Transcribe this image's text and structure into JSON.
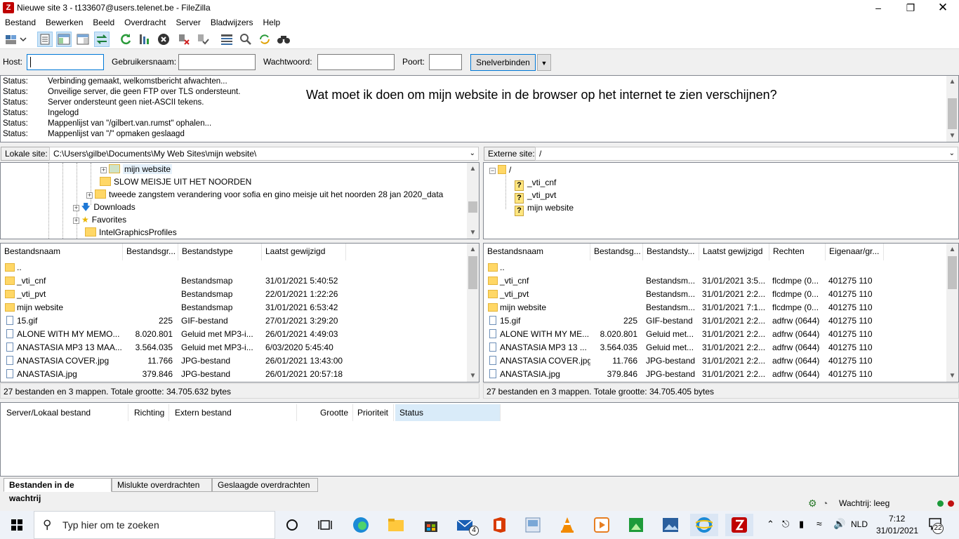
{
  "window": {
    "title": "Nieuwe site 3 - t133607@users.telenet.be - FileZilla",
    "app_icon": "Z"
  },
  "menu": [
    "Bestand",
    "Bewerken",
    "Beeld",
    "Overdracht",
    "Server",
    "Bladwijzers",
    "Help"
  ],
  "toolbar_icons": [
    "site-manager-icon",
    "toggle-log-icon",
    "toggle-local-tree-icon",
    "toggle-remote-tree-icon",
    "transfer-queue-icon",
    "refresh-icon",
    "process-queue-icon",
    "cancel-icon",
    "disconnect-icon",
    "reconnect-icon",
    "directory-listing-filters-icon",
    "compare-icon",
    "sync-browse-icon",
    "search-files-icon"
  ],
  "quickconnect": {
    "host_label": "Host:",
    "host_value": "",
    "user_label": "Gebruikersnaam:",
    "user_value": "",
    "pass_label": "Wachtwoord:",
    "pass_value": "",
    "port_label": "Poort:",
    "port_value": "",
    "button": "Snelverbinden"
  },
  "log": [
    {
      "key": "Status:",
      "msg": "Verbinding gemaakt, welkomstbericht afwachten..."
    },
    {
      "key": "Status:",
      "msg": "Onveilige server, die geen FTP over TLS ondersteunt."
    },
    {
      "key": "Status:",
      "msg": "Server ondersteunt geen niet-ASCII tekens."
    },
    {
      "key": "Status:",
      "msg": "Ingelogd"
    },
    {
      "key": "Status:",
      "msg": "Mappenlijst van \"/gilbert.van.rumst\" ophalen..."
    },
    {
      "key": "Status:",
      "msg": "Mappenlijst van \"/\" opmaken geslaagd"
    }
  ],
  "overlay_question": "Wat moet ik doen om mijn website in de browser op het internet te zien verschijnen?",
  "local": {
    "site_label": "Lokale site:",
    "path": "C:\\Users\\gilbe\\Documents\\My Web Sites\\mijn website\\",
    "tree": [
      "mijn website",
      "SLOW MEISJE UIT HET NOORDEN",
      "tweede zangstem verandering voor sofia en gino meisje uit het noorden 28 jan 2020_data",
      "Downloads",
      "Favorites",
      "IntelGraphicsProfiles"
    ],
    "headers": [
      "Bestandsnaam",
      "Bestandsgr...",
      "Bestandstype",
      "Laatst gewijzigd"
    ],
    "files": [
      {
        "name": "..",
        "size": "",
        "type": "",
        "date": "",
        "icon": "folder"
      },
      {
        "name": "_vti_cnf",
        "size": "",
        "type": "Bestandsmap",
        "date": "31/01/2021 5:40:52",
        "icon": "folder"
      },
      {
        "name": "_vti_pvt",
        "size": "",
        "type": "Bestandsmap",
        "date": "22/01/2021 1:22:26",
        "icon": "folder"
      },
      {
        "name": "mijn website",
        "size": "",
        "type": "Bestandsmap",
        "date": "31/01/2021 6:53:42",
        "icon": "folder"
      },
      {
        "name": "15.gif",
        "size": "225",
        "type": "GIF-bestand",
        "date": "27/01/2021 3:29:20",
        "icon": "file"
      },
      {
        "name": "ALONE WITH MY MEMO...",
        "size": "8.020.801",
        "type": "Geluid met MP3-i...",
        "date": "26/01/2021 4:49:03",
        "icon": "file"
      },
      {
        "name": "ANASTASIA  MP3 13 MAA...",
        "size": "3.564.035",
        "type": "Geluid met MP3-i...",
        "date": "6/03/2020 5:45:40",
        "icon": "file"
      },
      {
        "name": "ANASTASIA COVER.jpg",
        "size": "11.766",
        "type": "JPG-bestand",
        "date": "26/01/2021 13:43:00",
        "icon": "file"
      },
      {
        "name": "ANASTASIA.jpg",
        "size": "379.846",
        "type": "JPG-bestand",
        "date": "26/01/2021 20:57:18",
        "icon": "file"
      }
    ],
    "summary": "27 bestanden en 3 mappen. Totale grootte: 34.705.632 bytes"
  },
  "remote": {
    "site_label": "Externe site:",
    "path": "/",
    "tree": [
      "/",
      "_vti_cnf",
      "_vti_pvt",
      "mijn website"
    ],
    "headers": [
      "Bestandsnaam",
      "Bestandsg...",
      "Bestandsty...",
      "Laatst gewijzigd",
      "Rechten",
      "Eigenaar/gr..."
    ],
    "files": [
      {
        "name": "..",
        "size": "",
        "type": "",
        "date": "",
        "perm": "",
        "owner": "",
        "icon": "folder"
      },
      {
        "name": "_vti_cnf",
        "size": "",
        "type": "Bestandsm...",
        "date": "31/01/2021 3:5...",
        "perm": "flcdmpe (0...",
        "owner": "401275 110",
        "icon": "folder"
      },
      {
        "name": "_vti_pvt",
        "size": "",
        "type": "Bestandsm...",
        "date": "31/01/2021 2:2...",
        "perm": "flcdmpe (0...",
        "owner": "401275 110",
        "icon": "folder"
      },
      {
        "name": "mijn website",
        "size": "",
        "type": "Bestandsm...",
        "date": "31/01/2021 7:1...",
        "perm": "flcdmpe (0...",
        "owner": "401275 110",
        "icon": "folder"
      },
      {
        "name": "15.gif",
        "size": "225",
        "type": "GIF-bestand",
        "date": "31/01/2021 2:2...",
        "perm": "adfrw (0644)",
        "owner": "401275 110",
        "icon": "file"
      },
      {
        "name": "ALONE WITH MY ME...",
        "size": "8.020.801",
        "type": "Geluid met...",
        "date": "31/01/2021 2:2...",
        "perm": "adfrw (0644)",
        "owner": "401275 110",
        "icon": "file"
      },
      {
        "name": "ANASTASIA  MP3 13 ...",
        "size": "3.564.035",
        "type": "Geluid met...",
        "date": "31/01/2021 2:2...",
        "perm": "adfrw (0644)",
        "owner": "401275 110",
        "icon": "file"
      },
      {
        "name": "ANASTASIA COVER.jpg",
        "size": "11.766",
        "type": "JPG-bestand",
        "date": "31/01/2021 2:2...",
        "perm": "adfrw (0644)",
        "owner": "401275 110",
        "icon": "file"
      },
      {
        "name": "ANASTASIA.jpg",
        "size": "379.846",
        "type": "JPG-bestand",
        "date": "31/01/2021 2:2...",
        "perm": "adfrw (0644)",
        "owner": "401275 110",
        "icon": "file"
      }
    ],
    "summary": "27 bestanden en 3 mappen. Totale grootte: 34.705.405 bytes"
  },
  "queue": {
    "headers": [
      "Server/Lokaal bestand",
      "Richting",
      "Extern bestand",
      "Grootte",
      "Prioriteit",
      "Status"
    ],
    "tabs": [
      "Bestanden in de wachtrij",
      "Mislukte overdrachten",
      "Geslaagde overdrachten"
    ]
  },
  "statusbar": {
    "queue_text": "Wachtrij: leeg"
  },
  "taskbar": {
    "search_placeholder": "Typ hier om te zoeken",
    "language": "NLD",
    "time": "7:12",
    "date": "31/01/2021",
    "mail_badge": "4",
    "notification_count": "22"
  },
  "colors": {
    "accent": "#0078d7",
    "filezilla_red": "#bf0000",
    "folder": "#ffd766",
    "selected_header": "#cce8ff"
  }
}
